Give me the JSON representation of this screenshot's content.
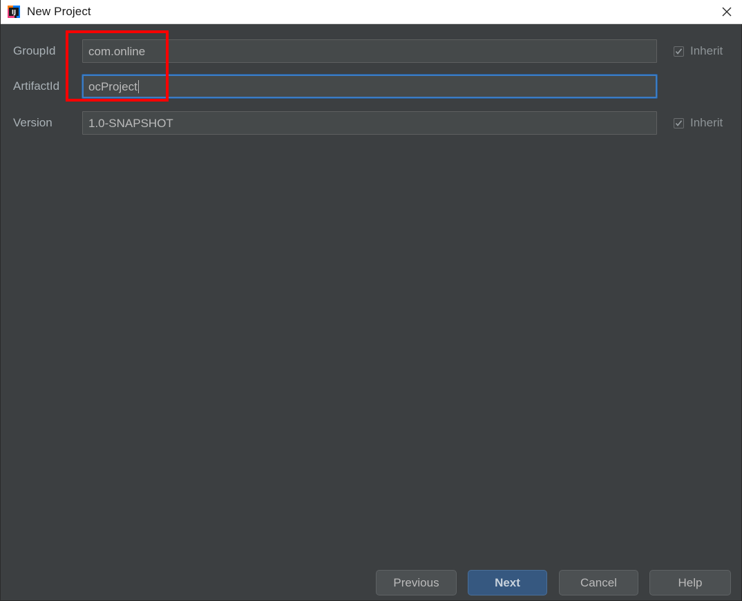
{
  "window": {
    "title": "New Project",
    "app_icon": "intellij-idea-icon",
    "close_icon": "close-icon",
    "titlebar_bg": "#ffffff",
    "content_bg": "#3c3f41"
  },
  "form": {
    "rows": [
      {
        "label": "GroupId",
        "value": "com.online",
        "placeholder": "",
        "focused": false,
        "has_inherit": true,
        "inherit_label": "Inherit",
        "inherit_checked": true
      },
      {
        "label": "ArtifactId",
        "value": "ocProject",
        "placeholder": "",
        "focused": true,
        "has_inherit": false,
        "inherit_label": "",
        "inherit_checked": false
      },
      {
        "label": "Version",
        "value": "1.0-SNAPSHOT",
        "placeholder": "",
        "focused": false,
        "has_inherit": true,
        "inherit_label": "Inherit",
        "inherit_checked": true
      }
    ]
  },
  "annotation": {
    "type": "highlight-rectangle",
    "color": "#fe0000"
  },
  "buttons": {
    "previous": "Previous",
    "next": "Next",
    "cancel": "Cancel",
    "help": "Help",
    "primary": "Next",
    "primary_color": "#365880"
  }
}
